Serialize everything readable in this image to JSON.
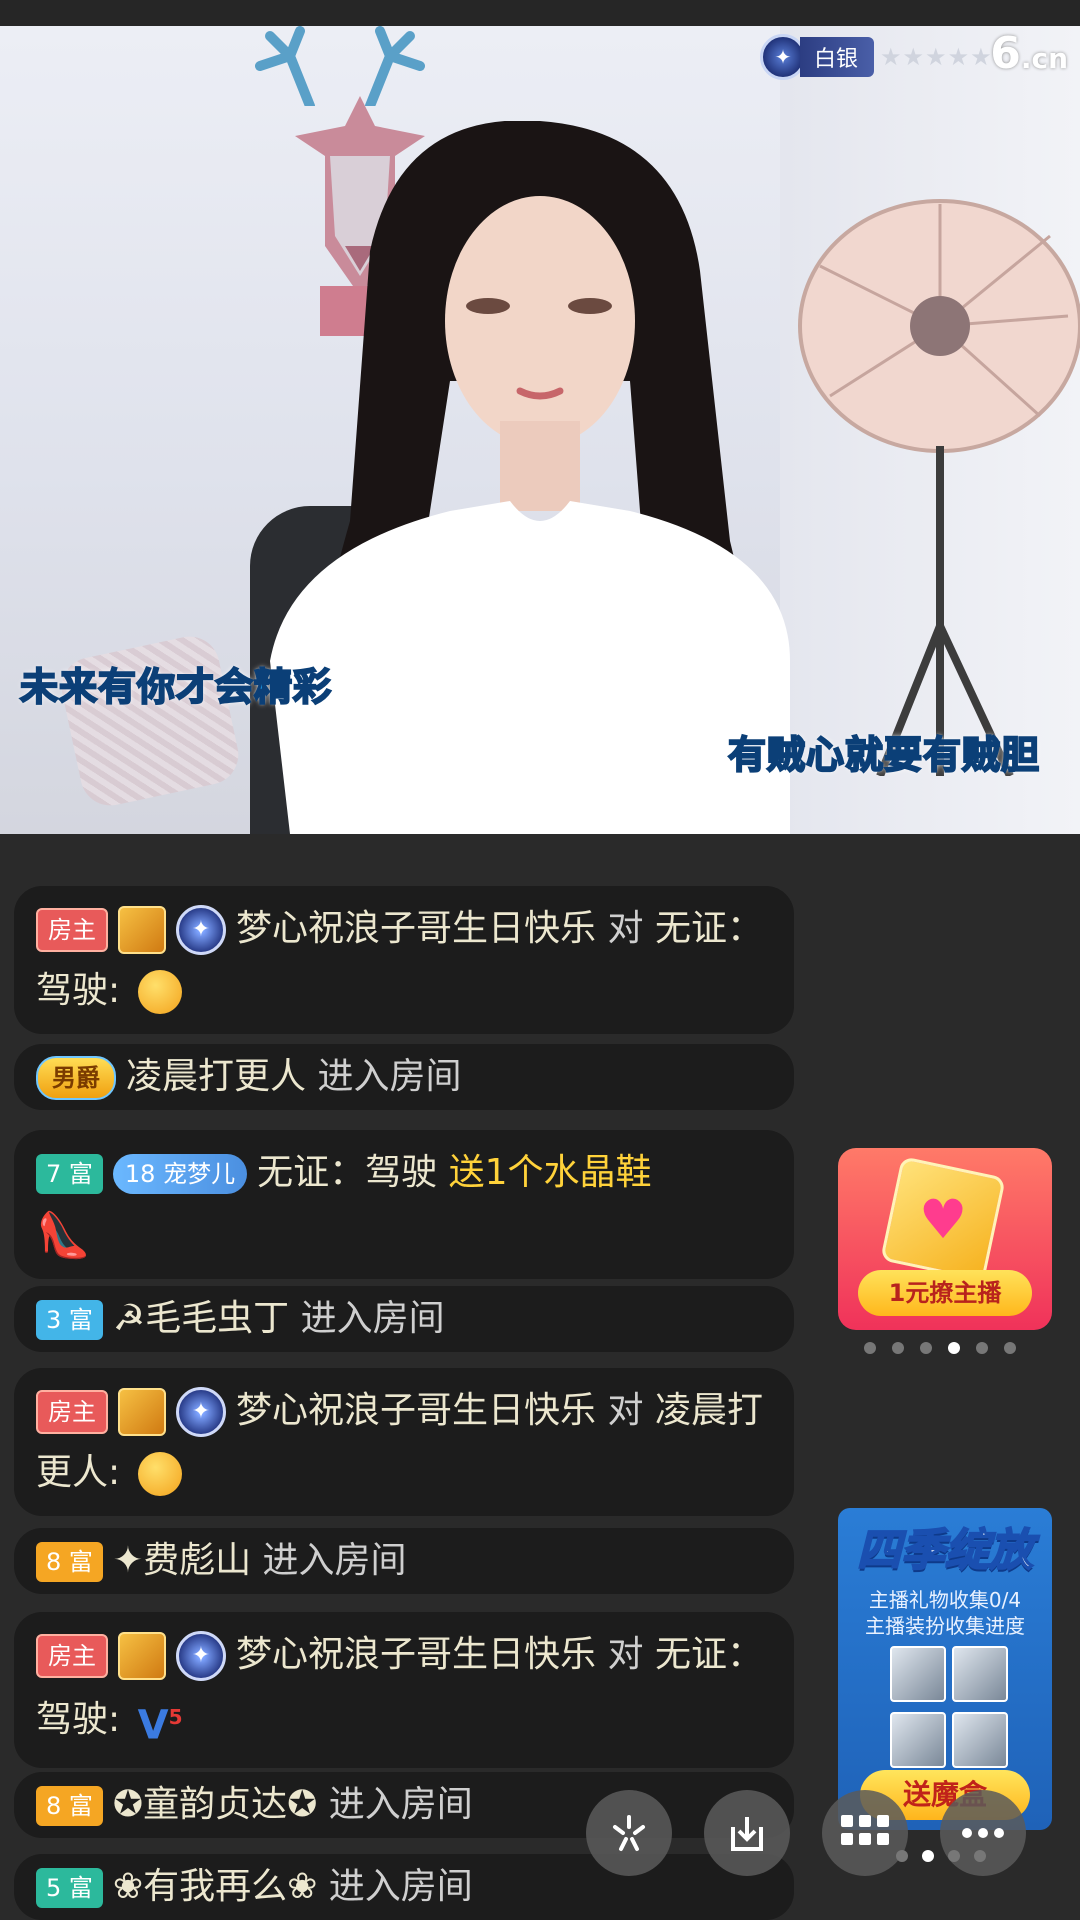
{
  "stream": {
    "level_badge": "白银",
    "stars": "★★★★★",
    "logo_main": "6",
    "logo_suffix": ".cn",
    "caption_left": "未来有你才会精彩",
    "caption_right": "有贼心就要有贼胆"
  },
  "chat": {
    "messages": [
      {
        "tag": "房主",
        "user": "梦心祝浪子哥生日快乐",
        "action": "对",
        "text": "无证：驾驶:"
      },
      {
        "tag": "男爵",
        "user": "凌晨打更人",
        "action": "进入房间"
      },
      {
        "tag": "7 富",
        "fan_badge": "宠梦儿",
        "fan_level": "18",
        "user": "无证：驾驶",
        "gift": "送1个水晶鞋"
      },
      {
        "tag": "3 富",
        "user": "☭毛毛虫丁",
        "action": "进入房间"
      },
      {
        "tag": "房主",
        "user": "梦心祝浪子哥生日快乐",
        "action": "对",
        "text": "凌晨打更人:"
      },
      {
        "tag": "8 富",
        "user": "✦费彪山",
        "action": "进入房间"
      },
      {
        "tag": "房主",
        "user": "梦心祝浪子哥生日快乐",
        "action": "对",
        "text": "无证：驾驶:",
        "emoji": "5"
      },
      {
        "tag": "8 富",
        "user": "✪童韵贞达✪",
        "action": "进入房间"
      },
      {
        "tag": "5 富",
        "user": "❀有我再么❀",
        "action": "进入房间"
      }
    ]
  },
  "promos": {
    "promo1_button": "1元撩主播",
    "promo2_title": "四季绽放",
    "promo2_line1": "主播礼物收集0/4",
    "promo2_line2": "主播装扮收集进度",
    "promo2_button": "送魔盒"
  },
  "carousel": {
    "count": 6,
    "active_index": 3
  },
  "icons": {
    "toolbar": [
      "share-icon",
      "download-icon",
      "grid-icon",
      "more-icon"
    ]
  },
  "colors": {
    "host_tag": "#e85a5a",
    "gift_text": "#ffd23a",
    "chat_bg": "#1c1c1c",
    "caption": "#1b8fd8"
  }
}
